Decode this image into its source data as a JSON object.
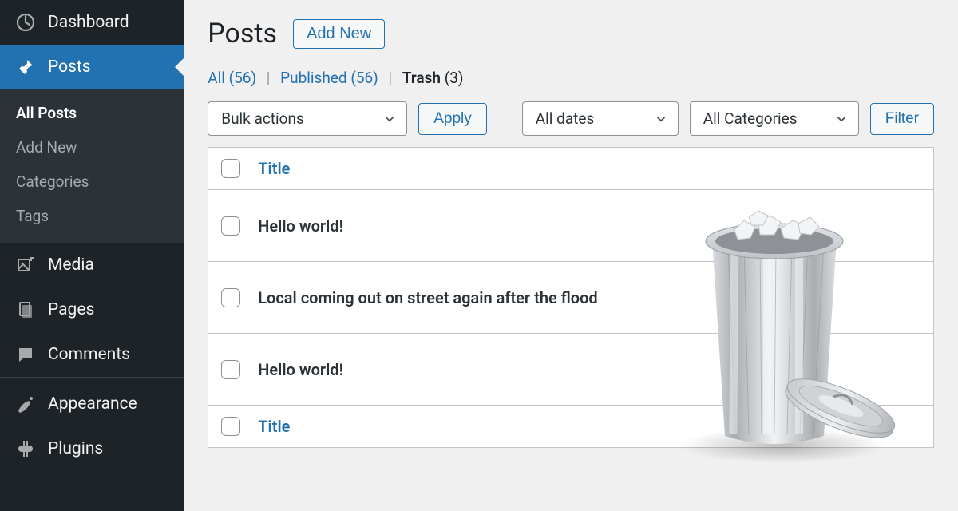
{
  "sidebar": {
    "dashboard": "Dashboard",
    "posts": "Posts",
    "sub": {
      "all": "All Posts",
      "add": "Add New",
      "cat": "Categories",
      "tags": "Tags"
    },
    "media": "Media",
    "pages": "Pages",
    "comments": "Comments",
    "appearance": "Appearance",
    "plugins": "Plugins"
  },
  "header": {
    "title": "Posts",
    "add_new": "Add New"
  },
  "filters": {
    "all_label": "All",
    "all_count": "(56)",
    "published_label": "Published",
    "published_count": "(56)",
    "trash_label": "Trash",
    "trash_count": "(3)"
  },
  "toolbar": {
    "bulk": "Bulk actions",
    "apply": "Apply",
    "dates": "All dates",
    "cats": "All Categories",
    "filter": "Filter"
  },
  "table": {
    "title_col": "Title",
    "rows": [
      "Hello world!",
      "Local coming out on street again after the flood",
      "Hello world!"
    ]
  }
}
